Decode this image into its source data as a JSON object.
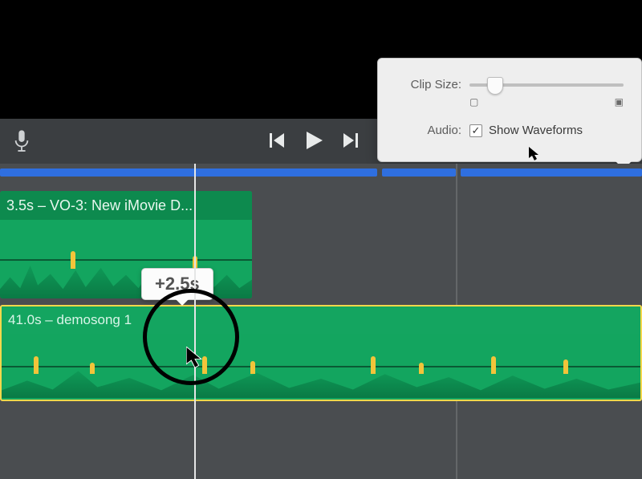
{
  "popover": {
    "clipSizeLabel": "Clip Size:",
    "audioLabel": "Audio:",
    "showWaveformsLabel": "Show Waveforms",
    "showWaveformsChecked": true
  },
  "tooltip": {
    "offset": "+2.5s"
  },
  "clips": {
    "vo": {
      "label": "3.5s – VO-3: New iMovie D..."
    },
    "song": {
      "label": "41.0s – demosong 1"
    }
  }
}
